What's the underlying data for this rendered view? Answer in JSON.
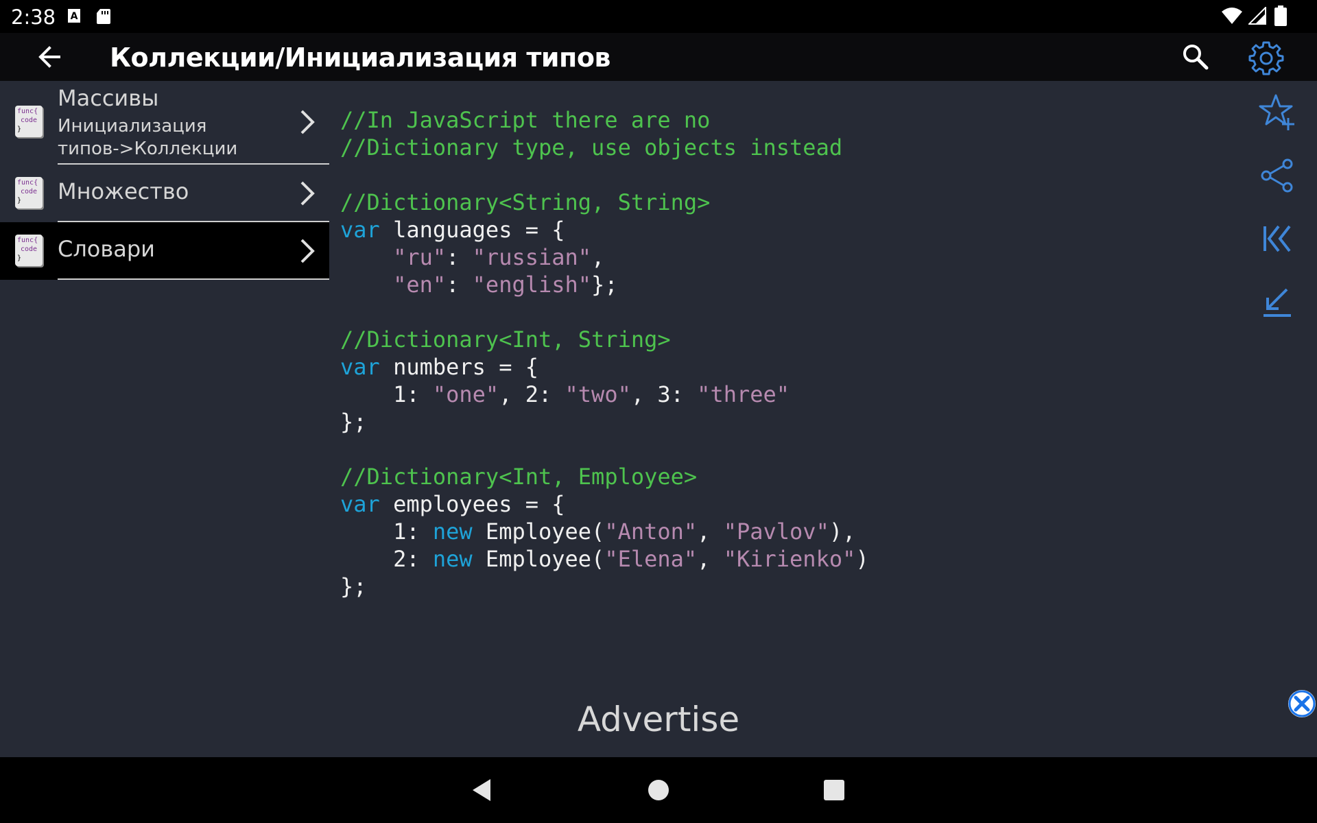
{
  "status_bar": {
    "time": "2:38",
    "left_icons": [
      "a-notification-icon",
      "sd-card-icon"
    ],
    "right_icons": [
      "wifi-icon",
      "signal-icon",
      "battery-icon"
    ]
  },
  "app_bar": {
    "title": "Коллекции/Инициализация типов",
    "icons": [
      "back-arrow-icon",
      "search-icon",
      "gear-icon"
    ]
  },
  "list": {
    "icon_text": {
      "line1": "func{",
      "line2": "code",
      "line3": "}"
    },
    "items": [
      {
        "title": "Массивы",
        "subtitle_line1": "Инициализация",
        "subtitle_line2": "типов->Коллекции",
        "selected": false
      },
      {
        "title": "Множество",
        "selected": false
      },
      {
        "title": "Словари",
        "selected": true
      }
    ]
  },
  "code": {
    "lines": [
      [
        {
          "t": "//In JavaScript there are no",
          "c": "cm"
        }
      ],
      [
        {
          "t": "//Dictionary type, use objects instead",
          "c": "cm"
        }
      ],
      [],
      [
        {
          "t": "//Dictionary<String, String>",
          "c": "cm"
        }
      ],
      [
        {
          "t": "var",
          "c": "kw"
        },
        {
          "t": " languages = {",
          "c": "pl"
        }
      ],
      [
        {
          "t": "    ",
          "c": "pl"
        },
        {
          "t": "\"ru\"",
          "c": "st"
        },
        {
          "t": ": ",
          "c": "pl"
        },
        {
          "t": "\"russian\"",
          "c": "st"
        },
        {
          "t": ",",
          "c": "pl"
        }
      ],
      [
        {
          "t": "    ",
          "c": "pl"
        },
        {
          "t": "\"en\"",
          "c": "st"
        },
        {
          "t": ": ",
          "c": "pl"
        },
        {
          "t": "\"english\"",
          "c": "st"
        },
        {
          "t": "};",
          "c": "pl"
        }
      ],
      [],
      [
        {
          "t": "//Dictionary<Int, String>",
          "c": "cm"
        }
      ],
      [
        {
          "t": "var",
          "c": "kw"
        },
        {
          "t": " numbers = {",
          "c": "pl"
        }
      ],
      [
        {
          "t": "    1: ",
          "c": "pl"
        },
        {
          "t": "\"one\"",
          "c": "st"
        },
        {
          "t": ", 2: ",
          "c": "pl"
        },
        {
          "t": "\"two\"",
          "c": "st"
        },
        {
          "t": ", 3: ",
          "c": "pl"
        },
        {
          "t": "\"three\"",
          "c": "st"
        }
      ],
      [
        {
          "t": "};",
          "c": "pl"
        }
      ],
      [],
      [
        {
          "t": "//Dictionary<Int, Employee>",
          "c": "cm"
        }
      ],
      [
        {
          "t": "var",
          "c": "kw"
        },
        {
          "t": " employees = {",
          "c": "pl"
        }
      ],
      [
        {
          "t": "    1: ",
          "c": "pl"
        },
        {
          "t": "new",
          "c": "kw"
        },
        {
          "t": " Employee(",
          "c": "pl"
        },
        {
          "t": "\"Anton\"",
          "c": "st"
        },
        {
          "t": ", ",
          "c": "pl"
        },
        {
          "t": "\"Pavlov\"",
          "c": "st"
        },
        {
          "t": "),",
          "c": "pl"
        }
      ],
      [
        {
          "t": "    2: ",
          "c": "pl"
        },
        {
          "t": "new",
          "c": "kw"
        },
        {
          "t": " Employee(",
          "c": "pl"
        },
        {
          "t": "\"Elena\"",
          "c": "st"
        },
        {
          "t": ", ",
          "c": "pl"
        },
        {
          "t": "\"Kirienko\"",
          "c": "st"
        },
        {
          "t": ")",
          "c": "pl"
        }
      ],
      [
        {
          "t": "};",
          "c": "pl"
        }
      ]
    ]
  },
  "right_rail": {
    "icons": [
      "star-add-icon",
      "share-icon",
      "skip-to-start-icon",
      "skip-to-end-icon"
    ]
  },
  "ad": {
    "label": "Advertise",
    "close_icon": "close-circle-icon"
  },
  "nav_bar": {
    "icons": [
      "nav-back-icon",
      "nav-home-icon",
      "nav-recents-icon"
    ]
  },
  "colors": {
    "background": "#262a35",
    "app_bar": "#0b0b0d",
    "comment": "#4ec34e",
    "keyword": "#1ea3d8",
    "string": "#b78ab0",
    "accent_icon": "#3f86d8"
  }
}
